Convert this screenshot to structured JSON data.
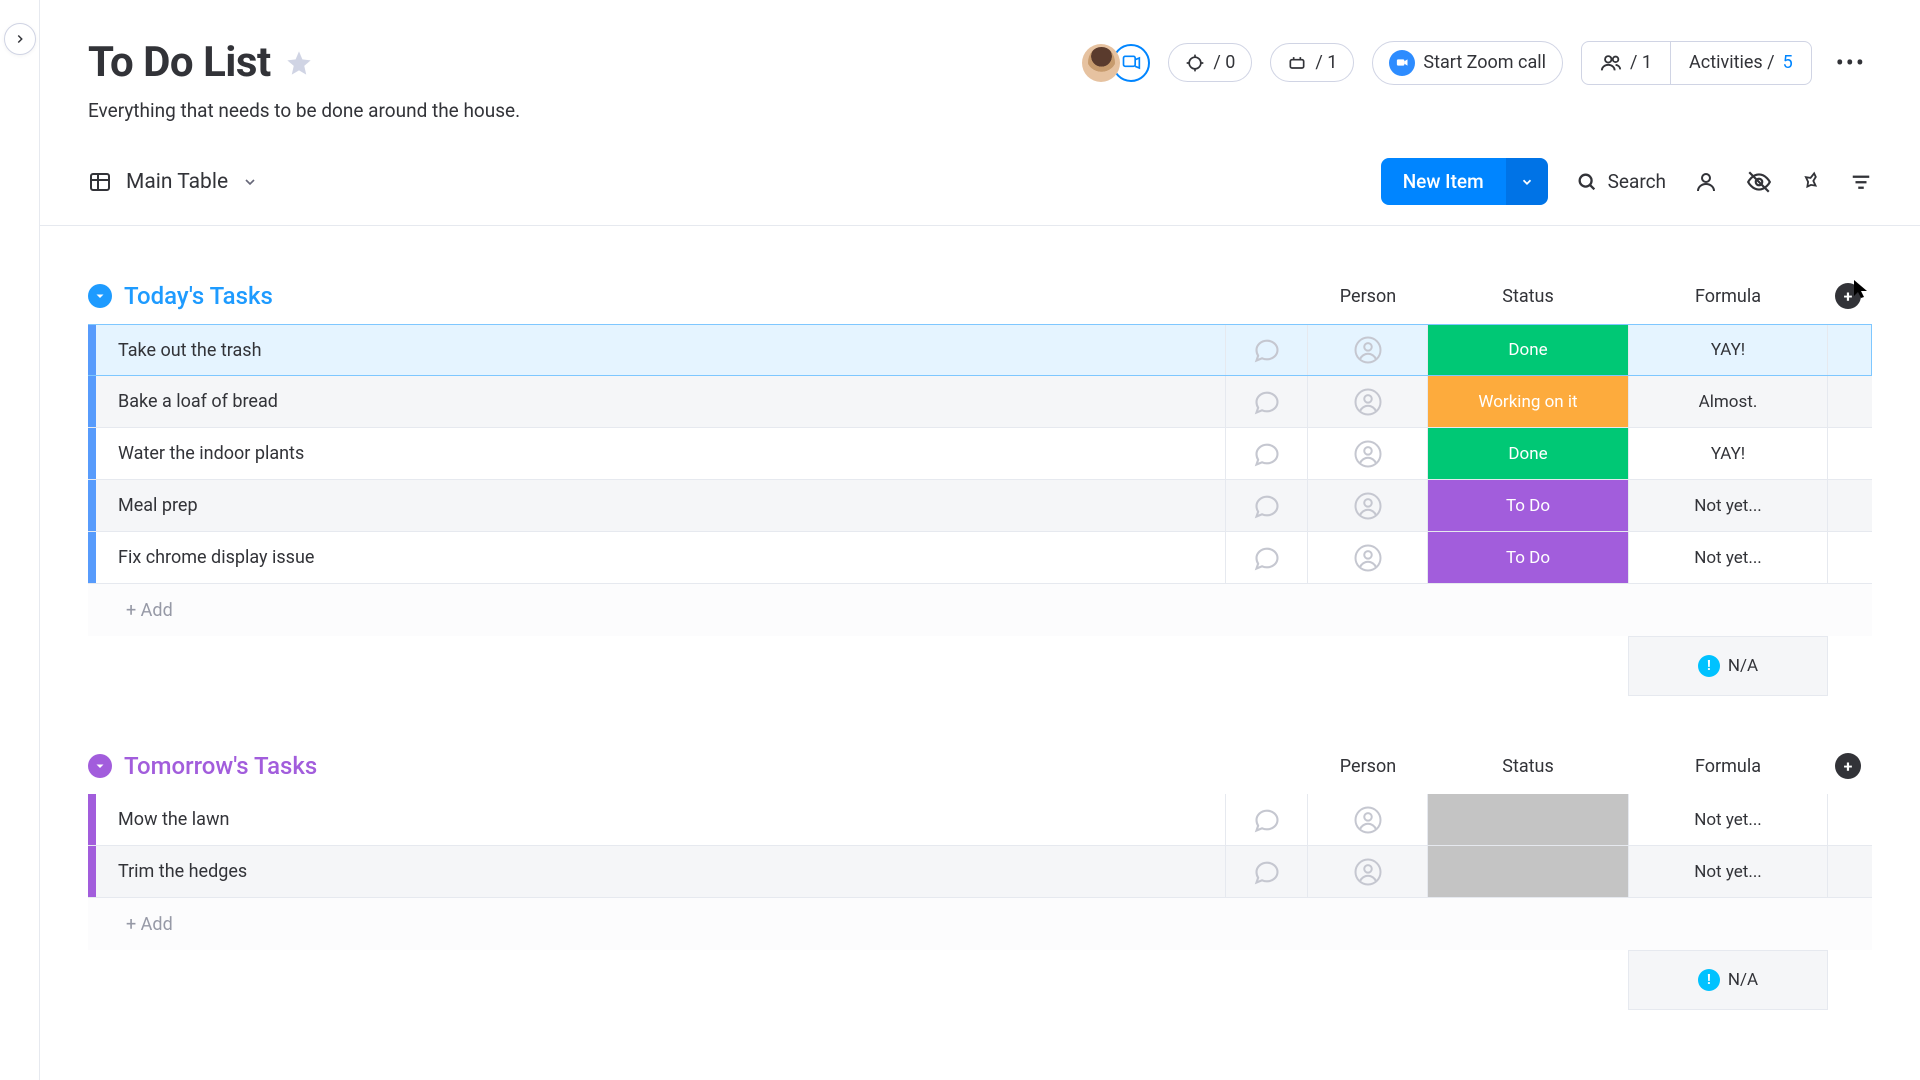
{
  "page": {
    "title": "To Do List",
    "subtitle": "Everything that needs to be done around the house."
  },
  "header": {
    "automations_count": "0",
    "integrations_count": "1",
    "zoom_label": "Start Zoom call",
    "members_count": "1",
    "activities_label": "Activities /",
    "activities_count": "5"
  },
  "view": {
    "name": "Main Table",
    "new_item_label": "New Item",
    "search_label": "Search"
  },
  "columns": {
    "person": "Person",
    "status": "Status",
    "formula": "Formula"
  },
  "groups": [
    {
      "id": "today",
      "title": "Today's Tasks",
      "add_label": "+ Add",
      "summary_formula": "N/A",
      "rows": [
        {
          "task": "Take out the trash",
          "status": "Done",
          "status_class": "status-done",
          "formula": "YAY!",
          "selected": true
        },
        {
          "task": "Bake a loaf of bread",
          "status": "Working on it",
          "status_class": "status-working",
          "formula": "Almost."
        },
        {
          "task": "Water the indoor plants",
          "status": "Done",
          "status_class": "status-done",
          "formula": "YAY!"
        },
        {
          "task": "Meal prep",
          "status": "To Do",
          "status_class": "status-todo",
          "formula": "Not yet..."
        },
        {
          "task": "Fix chrome display issue",
          "status": "To Do",
          "status_class": "status-todo",
          "formula": "Not yet..."
        }
      ]
    },
    {
      "id": "tomorrow",
      "title": "Tomorrow's Tasks",
      "add_label": "+ Add",
      "summary_formula": "N/A",
      "rows": [
        {
          "task": "Mow the lawn",
          "status": "",
          "status_class": "status-empty",
          "formula": "Not yet..."
        },
        {
          "task": "Trim the hedges",
          "status": "",
          "status_class": "status-empty",
          "formula": "Not yet..."
        }
      ]
    }
  ]
}
